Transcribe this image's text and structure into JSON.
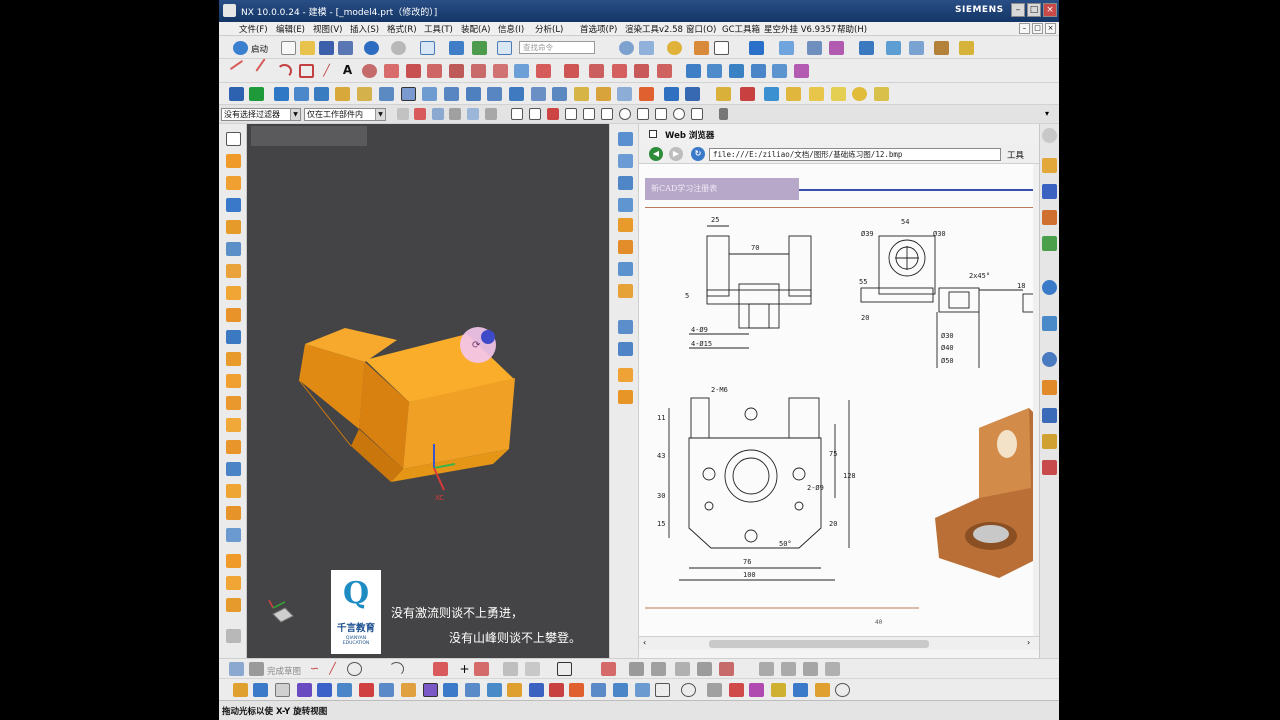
{
  "window": {
    "title": "NX 10.0.0.24 - 建模 - [_model4.prt（修改的）]",
    "brand": "SIEMENS"
  },
  "menubar": {
    "items": [
      "文件(F)",
      "编辑(E)",
      "视图(V)",
      "插入(S)",
      "格式(R)",
      "工具(T)",
      "装配(A)",
      "信息(I)",
      "分析(L)",
      "首选项(P)",
      "渲染工具v2.58",
      "窗口(O)",
      "GC工具箱",
      "星空外挂 V6.9357",
      "帮助(H)"
    ]
  },
  "toolbar": {
    "start_label": "启动",
    "search_placeholder": "查找命令",
    "filter_select": "没有选择过滤器",
    "scope_select": "仅在工作部件内"
  },
  "browser": {
    "panel_title": "Web 浏览器",
    "url": "file:///E:/ziliao/文档/图形/基础练习图/12.bmp",
    "tools_label": "工具"
  },
  "drawing": {
    "banner_text": "新CAD学习注册表",
    "page_number": "40",
    "dims": {
      "d25": "25",
      "d70": "70",
      "d5": "5",
      "d4phi9": "4-Ø9",
      "d4phi15": "4-Ø15",
      "d54": "54",
      "phi39": "Ø39",
      "phi30": "Ø30",
      "c2x45": "2x45°",
      "d55": "55",
      "d20": "20",
      "phi30b": "Ø30",
      "phi40": "Ø40",
      "phi50": "Ø50",
      "d18": "18",
      "m6": "2-M6",
      "d11": "11",
      "d43": "43",
      "d30": "30",
      "d15": "15",
      "d75": "75",
      "d128": "128",
      "phi9": "2-Ø9",
      "d20b": "20",
      "d50": "50°",
      "d76": "76",
      "d100": "100"
    }
  },
  "overlay": {
    "logo_text": "千言教育",
    "logo_sub": "QIANYAN EDUCATION",
    "caption_line1": "没有激流则谈不上勇进，",
    "caption_line2": "没有山峰则谈不上攀登。"
  },
  "viewport": {
    "axis_label": "XC"
  },
  "bottom": {
    "sketch_label": "完成草图"
  },
  "status": {
    "text": "拖动光标以使 X-Y 旋转视图"
  }
}
